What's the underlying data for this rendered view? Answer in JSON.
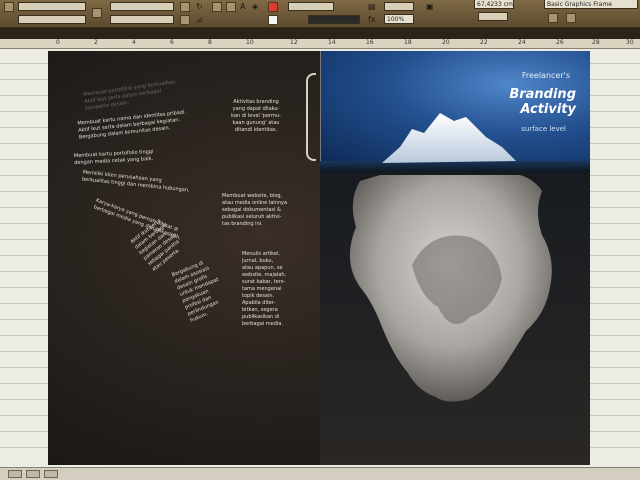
{
  "control_panel": {
    "zoom": "100%",
    "coordinate": "67,4233 cm",
    "style": "Basic Graphics Frame"
  },
  "ruler": {
    "ticks": [
      "0",
      "2",
      "4",
      "6",
      "8",
      "10",
      "12",
      "14",
      "16",
      "18",
      "20",
      "22",
      "24",
      "26",
      "28",
      "30"
    ]
  },
  "spread": {
    "right_page": {
      "title_small": "Freelancer's",
      "title_big": "Branding\nActivity",
      "title_sub": "surface level"
    },
    "left_page": {
      "text_blocks": [
        "Aktivitas branding\nyang dapat dilaku-\nkan di level 'permu-\nkaan gunung' atau\nditandi identitas.",
        "Membuat website, blog,\natau media online lainnya\nsebagai dokumentasi &\npublikasi seluruh aktivi-\ntas branding ini.",
        "Menulis artikel,\njurnal, buku,\natau apapun, se\nwebsite, majalah,\nsurat kabar, ters-\ntama mengenai\ntopik desain.\nApabila diter-\nbitkan, segera\npublikasikan di\nberbagai media."
      ],
      "fan_blocks": [
        "Membuat portofolio yang berkualitas.\nAktif ikut serta dalam berbagai\nkompetisi desain.",
        "Membuat kartu nama dan identitas pribadi.\nAktif ikut serta dalam berbagai kegiatan.\nBergabung dalam komunitas desain.",
        "Membuat kartu portofolio tinggi\ndengan media cetak yang baik.",
        "Memiliki klien perusahaan yang\nberkualitas tinggi dan membina hubungan.",
        "Karya-karya yang pernah dibuat di\nberbagai media yang dipublikasikan.",
        "Aktif ikut serta\ndalam berbagai\nkegiatan dan\npameran desain,\nsebagai panitia\natau peserta.",
        "Bergabung di\ndalam asosiasi\ndesain grafis\nuntuk mendapat\npengakuan\nprofesi dan\nperlindungan\nhukum."
      ]
    }
  }
}
